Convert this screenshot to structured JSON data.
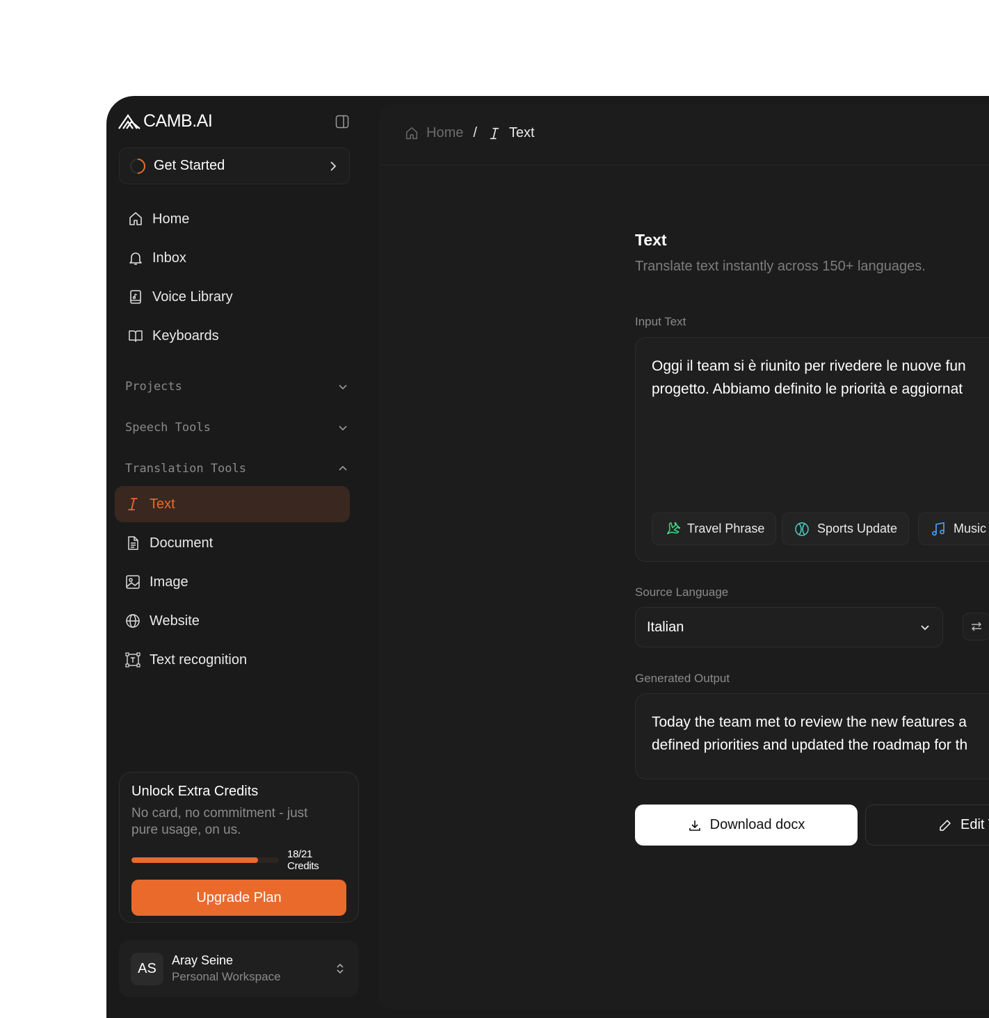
{
  "brand": {
    "name": "CAMB.AI"
  },
  "get_started": {
    "label": "Get Started"
  },
  "nav": [
    {
      "label": "Home",
      "icon": "home-icon"
    },
    {
      "label": "Inbox",
      "icon": "bell-icon"
    },
    {
      "label": "Voice Library",
      "icon": "voice-book-icon"
    },
    {
      "label": "Keyboards",
      "icon": "open-book-icon"
    }
  ],
  "sections": {
    "projects": "Projects",
    "speech_tools": "Speech Tools",
    "translation_tools": "Translation Tools"
  },
  "translation_tools": [
    {
      "label": "Text",
      "icon": "text-cursor-icon",
      "active": true
    },
    {
      "label": "Document",
      "icon": "document-icon"
    },
    {
      "label": "Image",
      "icon": "image-icon"
    },
    {
      "label": "Website",
      "icon": "globe-icon"
    },
    {
      "label": "Text recognition",
      "icon": "text-scan-icon"
    }
  ],
  "credits": {
    "title": "Unlock Extra Credits",
    "description": "No card, no commitment - just pure usage, on us.",
    "used": 18,
    "total": 21,
    "label": "18/21 Credits",
    "upgrade_label": "Upgrade Plan"
  },
  "user": {
    "initials": "AS",
    "name": "Aray Seine",
    "workspace": "Personal Workspace"
  },
  "breadcrumb": {
    "home": "Home",
    "separator": "/",
    "current": "Text"
  },
  "page": {
    "title": "Text",
    "subtitle": "Translate text instantly across 150+ languages."
  },
  "input": {
    "label": "Input Text",
    "line1": "Oggi il team si è riunito per rivedere le nuove fun",
    "line2": "progetto. Abbiamo definito le priorità e aggiornat"
  },
  "chips": [
    {
      "label": "Travel Phrase",
      "icon": "airplane-icon",
      "color": "#3ddc84"
    },
    {
      "label": "Sports Update",
      "icon": "tennis-ball-icon",
      "color": "#4fd1c5"
    },
    {
      "label": "Music",
      "icon": "music-note-icon",
      "color": "#4aa8ff"
    }
  ],
  "source_language": {
    "label": "Source Language",
    "value": "Italian"
  },
  "output": {
    "label": "Generated Output",
    "line1": "Today the team met to review the new features a",
    "line2": "defined priorities and updated the roadmap for th"
  },
  "actions": {
    "download_label": "Download docx",
    "edit_label": "Edit T"
  },
  "colors": {
    "accent": "#ea6a2c",
    "background": "#1a1a1a"
  }
}
